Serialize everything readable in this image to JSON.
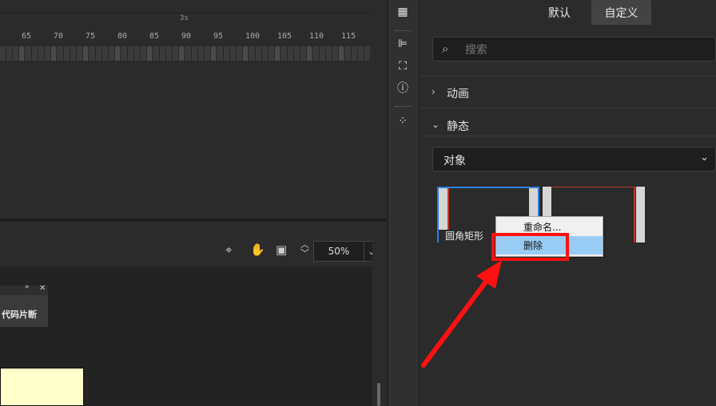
{
  "timeline": {
    "time_marker": "3s",
    "frame_numbers": [
      "65",
      "70",
      "75",
      "80",
      "85",
      "90",
      "95",
      "100",
      "105",
      "110",
      "115"
    ]
  },
  "stage_toolbar": {
    "zoom_value": "50%"
  },
  "mini_panel": {
    "label": "代码片断"
  },
  "tabs": {
    "default_label": "默认",
    "custom_label": "自定义"
  },
  "search": {
    "placeholder": "搜索"
  },
  "sections": {
    "animation": "动画",
    "static": "静态"
  },
  "dropdown": {
    "selected": "对象"
  },
  "thumbnails": [
    {
      "label": "圆角矩形"
    },
    {
      "label": ""
    }
  ],
  "context_menu": {
    "rename": "重命名...",
    "delete": "删除"
  },
  "colors": {
    "annotation": "#ff1111",
    "selection": "#2b82e0",
    "menu_highlight": "#99ccf5"
  }
}
